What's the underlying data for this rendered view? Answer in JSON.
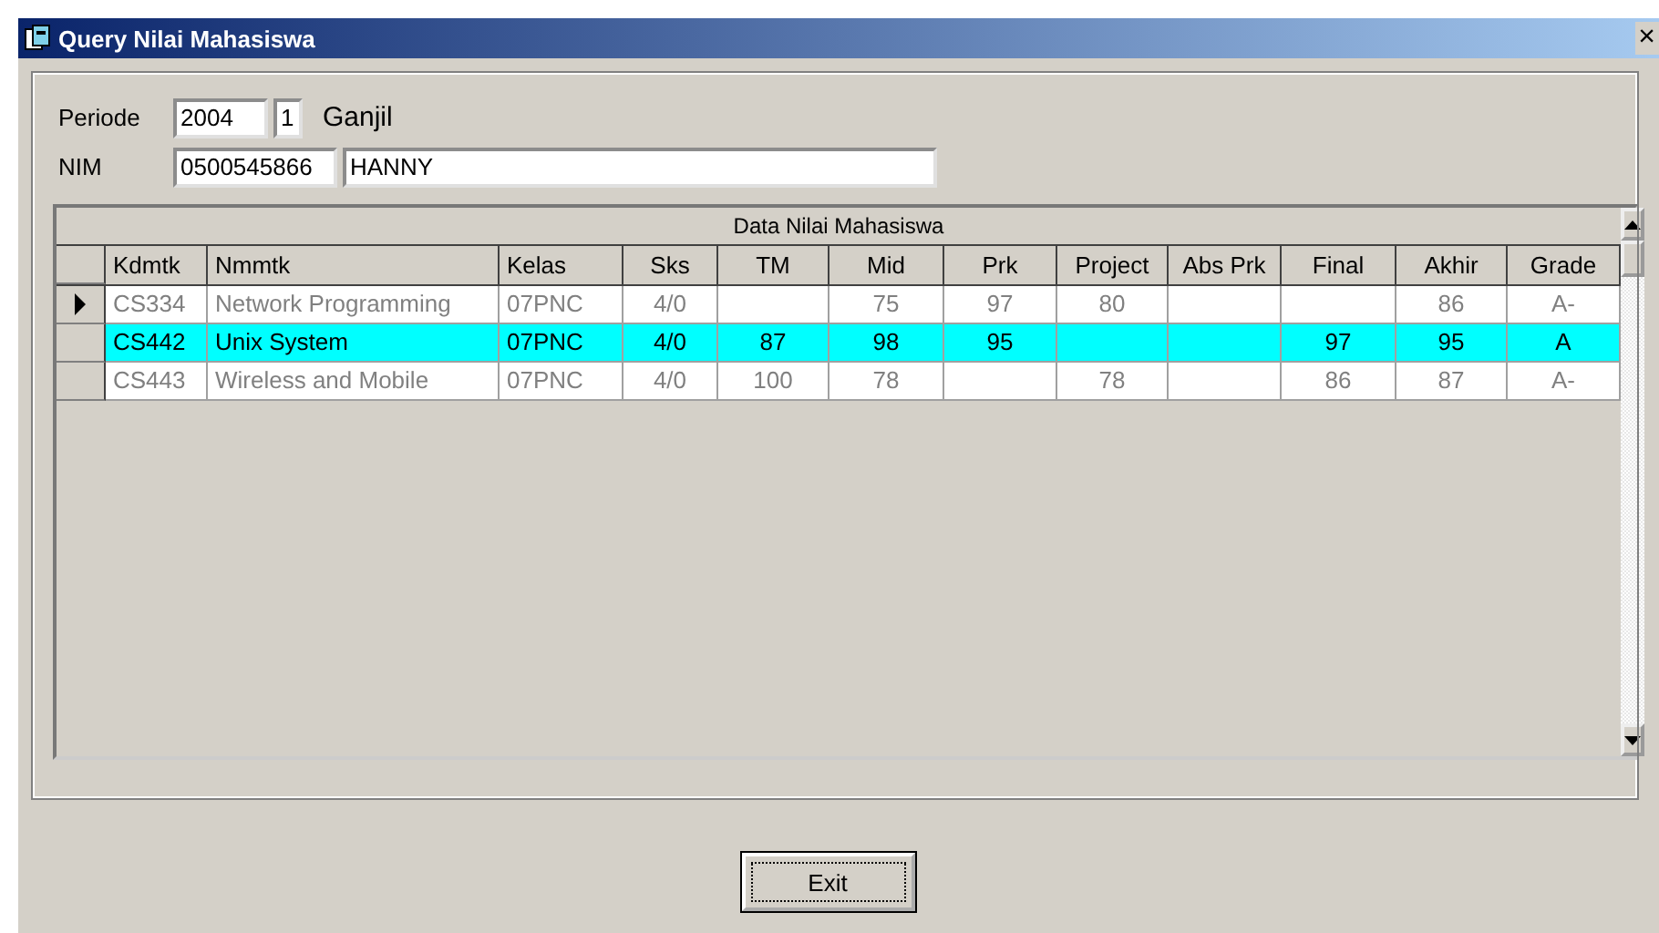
{
  "window": {
    "title": "Query Nilai Mahasiswa",
    "close": "×"
  },
  "form": {
    "periode_label": "Periode",
    "year": "2004",
    "semester": "1",
    "semester_name": "Ganjil",
    "nim_label": "NIM",
    "nim": "0500545866",
    "name": "HANNY"
  },
  "table": {
    "caption": "Data Nilai Mahasiswa",
    "columns": [
      {
        "label": "Kdmtk"
      },
      {
        "label": "Nmmtk"
      },
      {
        "label": "Kelas"
      },
      {
        "label": "Sks"
      },
      {
        "label": "TM"
      },
      {
        "label": "Mid"
      },
      {
        "label": "Prk"
      },
      {
        "label": "Project"
      },
      {
        "label": "Abs Prk"
      },
      {
        "label": "Final"
      },
      {
        "label": "Akhir"
      },
      {
        "label": "Grade"
      }
    ],
    "rows": [
      {
        "current": true,
        "selected": false,
        "cells": [
          "CS334",
          "Network Programming",
          "07PNC",
          "4/0",
          "",
          "75",
          "97",
          "80",
          "",
          "",
          "86",
          "A-"
        ]
      },
      {
        "current": false,
        "selected": true,
        "cells": [
          "CS442",
          "Unix System",
          "07PNC",
          "4/0",
          "87",
          "98",
          "95",
          "",
          "",
          "97",
          "95",
          "A"
        ]
      },
      {
        "current": false,
        "selected": false,
        "cells": [
          "CS443",
          "Wireless and Mobile",
          "07PNC",
          "4/0",
          "100",
          "78",
          "",
          "78",
          "",
          "86",
          "87",
          "A-"
        ]
      }
    ]
  },
  "buttons": [
    {
      "label": "Exit"
    }
  ]
}
